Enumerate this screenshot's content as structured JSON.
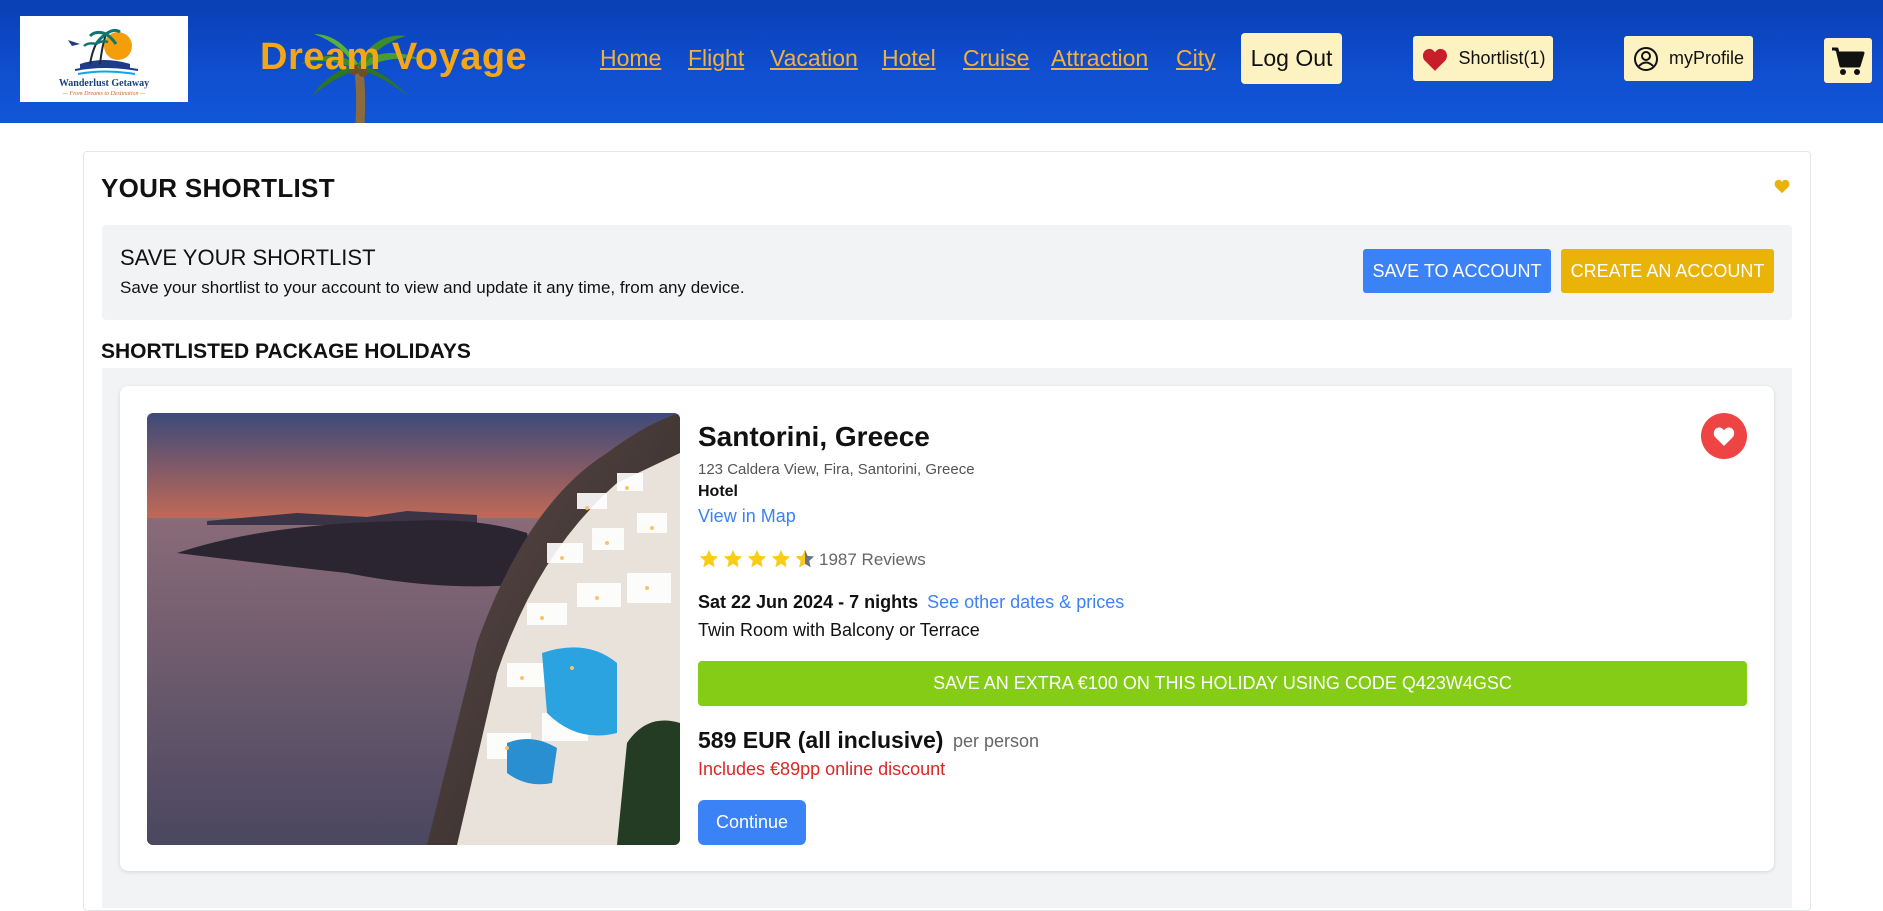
{
  "header": {
    "logo_name": "Wanderlust Getaway",
    "logo_tagline": "— From Dreams to Destination —",
    "brand": "Dream Voyage",
    "nav": [
      "Home",
      "Flight",
      "Vacation",
      "Hotel",
      "Cruise",
      "Attraction",
      "City"
    ],
    "logout_label": "Log Out",
    "shortlist_label": "Shortlist(1)",
    "profile_label": "myProfile",
    "accent_color": "#f3a718",
    "bg_color": "#0f4fd0"
  },
  "shortlist": {
    "title": "YOUR SHORTLIST",
    "save_box": {
      "title": "SAVE YOUR SHORTLIST",
      "description": "Save your shortlist to your account to view and update it any time, from any device.",
      "save_button": "SAVE TO ACCOUNT",
      "create_button": "CREATE AN ACCOUNT"
    },
    "section_title": "SHORTLISTED PACKAGE HOLIDAYS"
  },
  "package": {
    "title": "Santorini, Greece",
    "address": "123 Caldera View, Fira, Santorini, Greece",
    "type": "Hotel",
    "map_link": "View in Map",
    "rating": 4.5,
    "reviews": "1987 Reviews",
    "dates": "Sat 22 Jun 2024 - 7 nights",
    "dates_link": "See other dates & prices",
    "room": "Twin Room with Balcony or Terrace",
    "promo": "SAVE AN EXTRA €100 ON THIS HOLIDAY USING CODE Q423W4GSC",
    "price": "589 EUR (all inclusive)",
    "per": "per person",
    "discount": "Includes €89pp online discount",
    "continue_label": "Continue"
  },
  "colors": {
    "primary": "#3b82f6",
    "warning": "#eab308",
    "success": "#84cc16",
    "danger": "#ef4444"
  },
  "icons": [
    "heart-icon",
    "user-circle-icon",
    "cart-icon",
    "star-icon"
  ]
}
